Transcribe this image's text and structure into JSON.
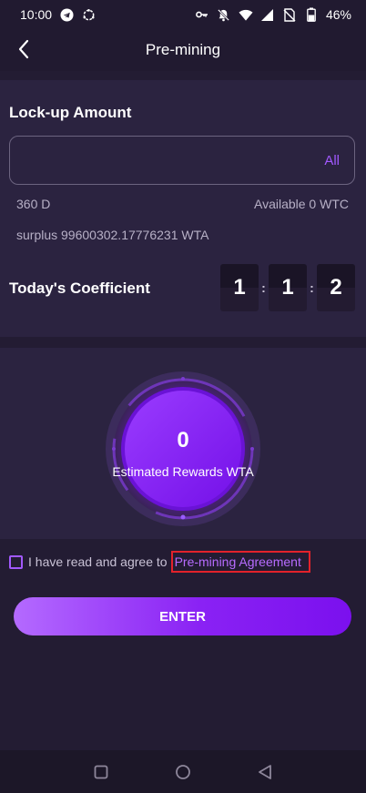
{
  "status_bar": {
    "time": "10:00",
    "battery": "46%"
  },
  "header": {
    "title": "Pre-mining"
  },
  "lockup": {
    "title": "Lock-up Amount",
    "input_value": "",
    "input_placeholder": "",
    "all_label": "All",
    "period": "360 D",
    "available": "Available 0 WTC",
    "surplus": "surplus 99600302.17776231 WTA"
  },
  "coefficient": {
    "label": "Today's Coefficient",
    "digits": [
      "1",
      "1",
      "2"
    ],
    "separator": ":"
  },
  "rewards": {
    "value": "0",
    "label": "Estimated Rewards WTA"
  },
  "agreement": {
    "text": "I have read and agree to",
    "link": "Pre-mining Agreement"
  },
  "enter_button": {
    "label": "ENTER"
  },
  "colors": {
    "background": "#231c33",
    "card": "#2b2340",
    "accent": "#a259ff",
    "highlight_border": "#e3222b"
  },
  "icons": {
    "status_left": [
      "telegram-icon",
      "sync-icon"
    ],
    "status_right": [
      "key-icon",
      "bell-off-icon",
      "wifi-icon",
      "signal-icon",
      "no-sim-icon",
      "battery-icon"
    ],
    "nav": [
      "recents-square-icon",
      "home-circle-icon",
      "back-triangle-icon"
    ]
  }
}
